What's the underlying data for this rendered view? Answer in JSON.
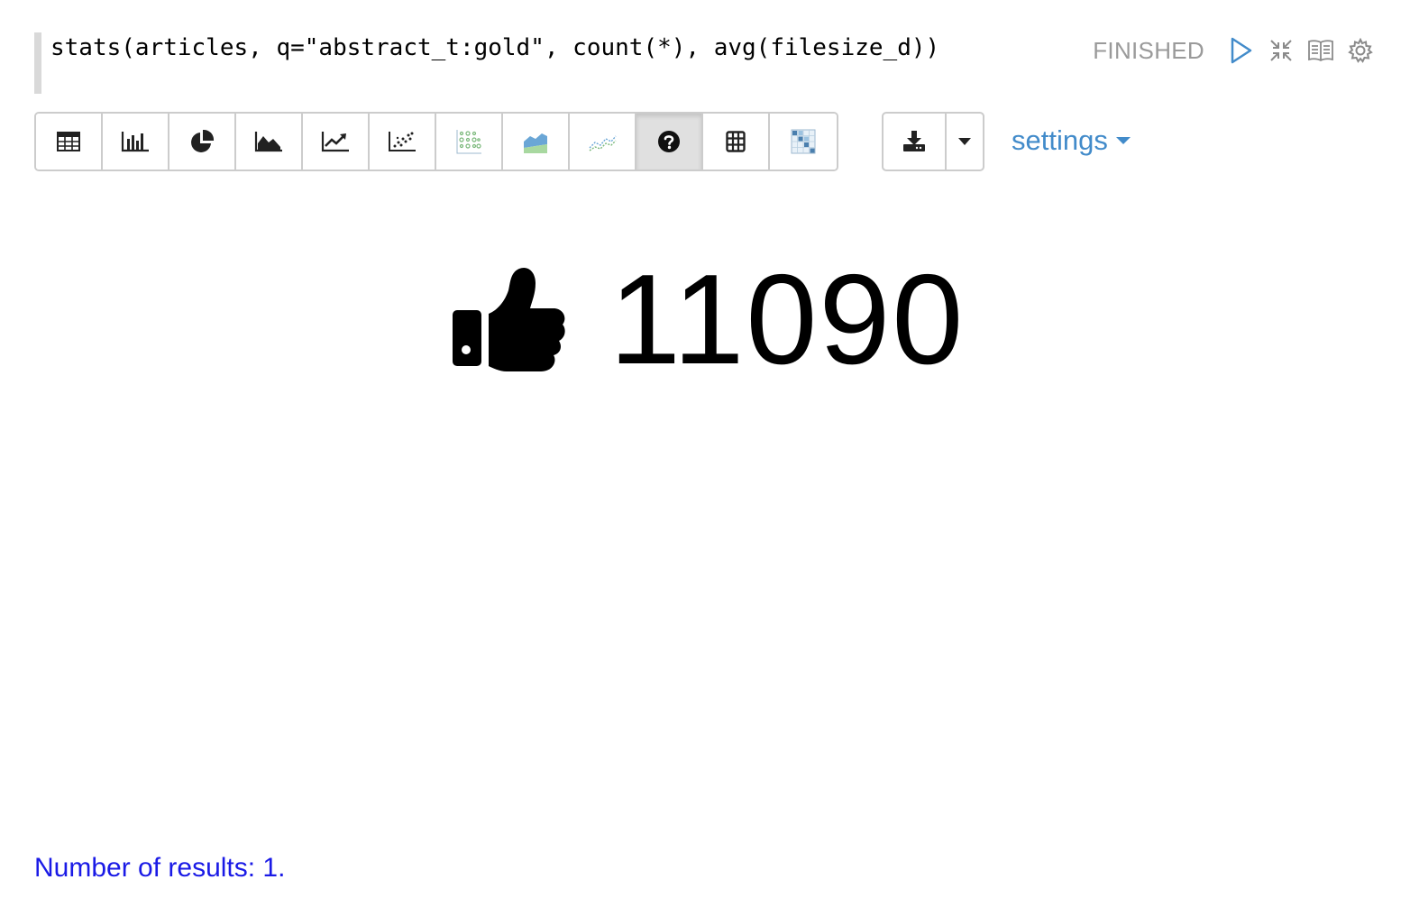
{
  "paragraph": {
    "code": "stats(articles, q=\"abstract_t:gold\", count(*), avg(filesize_d))",
    "status": "FINISHED"
  },
  "toolbar": {
    "buttons": [
      {
        "name": "table",
        "icon": "table-icon"
      },
      {
        "name": "bar-chart",
        "icon": "bar-chart-icon"
      },
      {
        "name": "pie-chart",
        "icon": "pie-chart-icon"
      },
      {
        "name": "area-chart",
        "icon": "area-chart-icon"
      },
      {
        "name": "line-chart",
        "icon": "line-chart-icon"
      },
      {
        "name": "scatter-chart",
        "icon": "scatter-chart-icon"
      },
      {
        "name": "heatmap",
        "icon": "heatmap-icon"
      },
      {
        "name": "stacked-area",
        "icon": "stacked-area-icon"
      },
      {
        "name": "multi-line",
        "icon": "multi-line-icon"
      },
      {
        "name": "number",
        "icon": "question-circle-icon",
        "active": true
      },
      {
        "name": "grid",
        "icon": "grid-icon"
      },
      {
        "name": "matrix",
        "icon": "matrix-icon"
      }
    ],
    "settings_label": "settings"
  },
  "result": {
    "icon": "thumbs-up-icon",
    "value": "11090"
  },
  "footer": {
    "text": "Number of results: 1."
  },
  "colors": {
    "accent": "#428bca",
    "status": "#9a9a9a",
    "footer": "#1a1ae6",
    "chart_green": "#8fce8f",
    "chart_blue": "#6aa6d6"
  }
}
